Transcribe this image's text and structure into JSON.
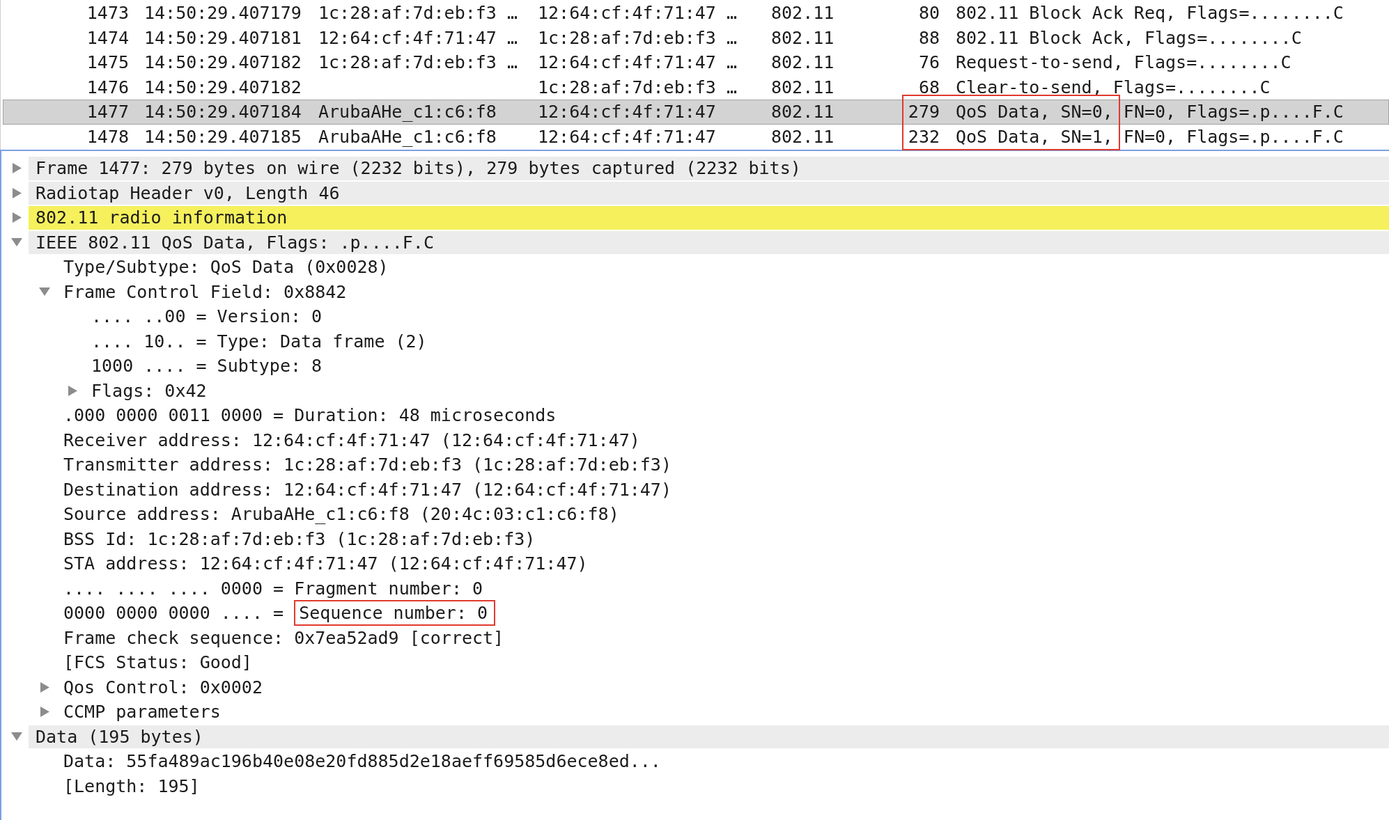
{
  "packet_list": {
    "packets": [
      {
        "no": "1473",
        "time": "14:50:29.407179",
        "source": "1c:28:af:7d:eb:f3 …",
        "destination": "12:64:cf:4f:71:47 …",
        "protocol": "802.11",
        "length": "80",
        "info": "802.11 Block Ack Req, Flags=........C",
        "selected": false,
        "marked": false
      },
      {
        "no": "1474",
        "time": "14:50:29.407181",
        "source": "12:64:cf:4f:71:47 …",
        "destination": "1c:28:af:7d:eb:f3 …",
        "protocol": "802.11",
        "length": "88",
        "info": "802.11 Block Ack, Flags=........C",
        "selected": false,
        "marked": false
      },
      {
        "no": "1475",
        "time": "14:50:29.407182",
        "source": "1c:28:af:7d:eb:f3 …",
        "destination": "12:64:cf:4f:71:47 …",
        "protocol": "802.11",
        "length": "76",
        "info": "Request-to-send, Flags=........C",
        "selected": false,
        "marked": false
      },
      {
        "no": "1476",
        "time": "14:50:29.407182",
        "destination": "1c:28:af:7d:eb:f3 …",
        "protocol": "802.11",
        "length": "68",
        "info": "Clear-to-send, Flags=........C",
        "selected": false,
        "marked": false
      },
      {
        "no": "1477",
        "time": "14:50:29.407184",
        "source": "ArubaAHe_c1:c6:f8",
        "destination": "12:64:cf:4f:71:47",
        "protocol": "802.11",
        "length": "279",
        "info_marked": "QoS Data, SN=0,",
        "info": "FN=0, Flags=.p....F.C",
        "selected": true,
        "marked": true
      },
      {
        "no": "1478",
        "time": "14:50:29.407185",
        "source": "ArubaAHe_c1:c6:f8",
        "destination": "12:64:cf:4f:71:47",
        "protocol": "802.11",
        "length": "232",
        "info_marked": "QoS Data, SN=1,",
        "info": "FN=0, Flags=.p....F.C",
        "selected": false,
        "marked": true
      }
    ]
  },
  "packet_details": {
    "tree": [
      {
        "text": "Frame 1477: 279 bytes on wire (2232 bits), 279 bytes captured (2232 bits)",
        "expanded": false,
        "highlighted": false
      },
      {
        "text": "Radiotap Header v0, Length 46",
        "expanded": false,
        "highlighted": false
      },
      {
        "text": "802.11 radio information",
        "expanded": false,
        "highlighted": true
      },
      {
        "text": "IEEE 802.11 QoS Data, Flags: .p....F.C",
        "expanded": true,
        "highlighted": false,
        "children": [
          {
            "text": "Type/Subtype: QoS Data (0x0028)"
          },
          {
            "text": "Frame Control Field: 0x8842",
            "expanded": true,
            "children": [
              {
                "text": ".... ..00 = Version: 0"
              },
              {
                "text": ".... 10.. = Type: Data frame (2)"
              },
              {
                "text": "1000 .... = Subtype: 8"
              },
              {
                "text": "Flags: 0x42",
                "expanded": false
              }
            ]
          },
          {
            "text": ".000 0000 0011 0000 = Duration: 48 microseconds"
          },
          {
            "text": "Receiver address: 12:64:cf:4f:71:47 (12:64:cf:4f:71:47)"
          },
          {
            "text": "Transmitter address: 1c:28:af:7d:eb:f3 (1c:28:af:7d:eb:f3)"
          },
          {
            "text": "Destination address: 12:64:cf:4f:71:47 (12:64:cf:4f:71:47)"
          },
          {
            "text": "Source address: ArubaAHe_c1:c6:f8 (20:4c:03:c1:c6:f8)"
          },
          {
            "text": "BSS Id: 1c:28:af:7d:eb:f3 (1c:28:af:7d:eb:f3)"
          },
          {
            "text": "STA address: 12:64:cf:4f:71:47 (12:64:cf:4f:71:47)"
          },
          {
            "text": ".... .... .... 0000 = Fragment number: 0"
          },
          {
            "text": "0000 0000 0000 .... =",
            "marked_text": "Sequence number: 0"
          },
          {
            "text": "Frame check sequence: 0x7ea52ad9 [correct]"
          },
          {
            "text": "[FCS Status: Good]"
          },
          {
            "text": "Qos Control: 0x0002",
            "expanded": false
          },
          {
            "text": "CCMP parameters",
            "expanded": false
          }
        ]
      },
      {
        "text": "Data (195 bytes)",
        "expanded": true,
        "highlighted": false,
        "children": [
          {
            "text": "Data: 55fa489ac196b40e08e20fd885d2e18aeff69585d6ece8ed..."
          },
          {
            "text": "[Length: 195]"
          }
        ]
      }
    ]
  }
}
